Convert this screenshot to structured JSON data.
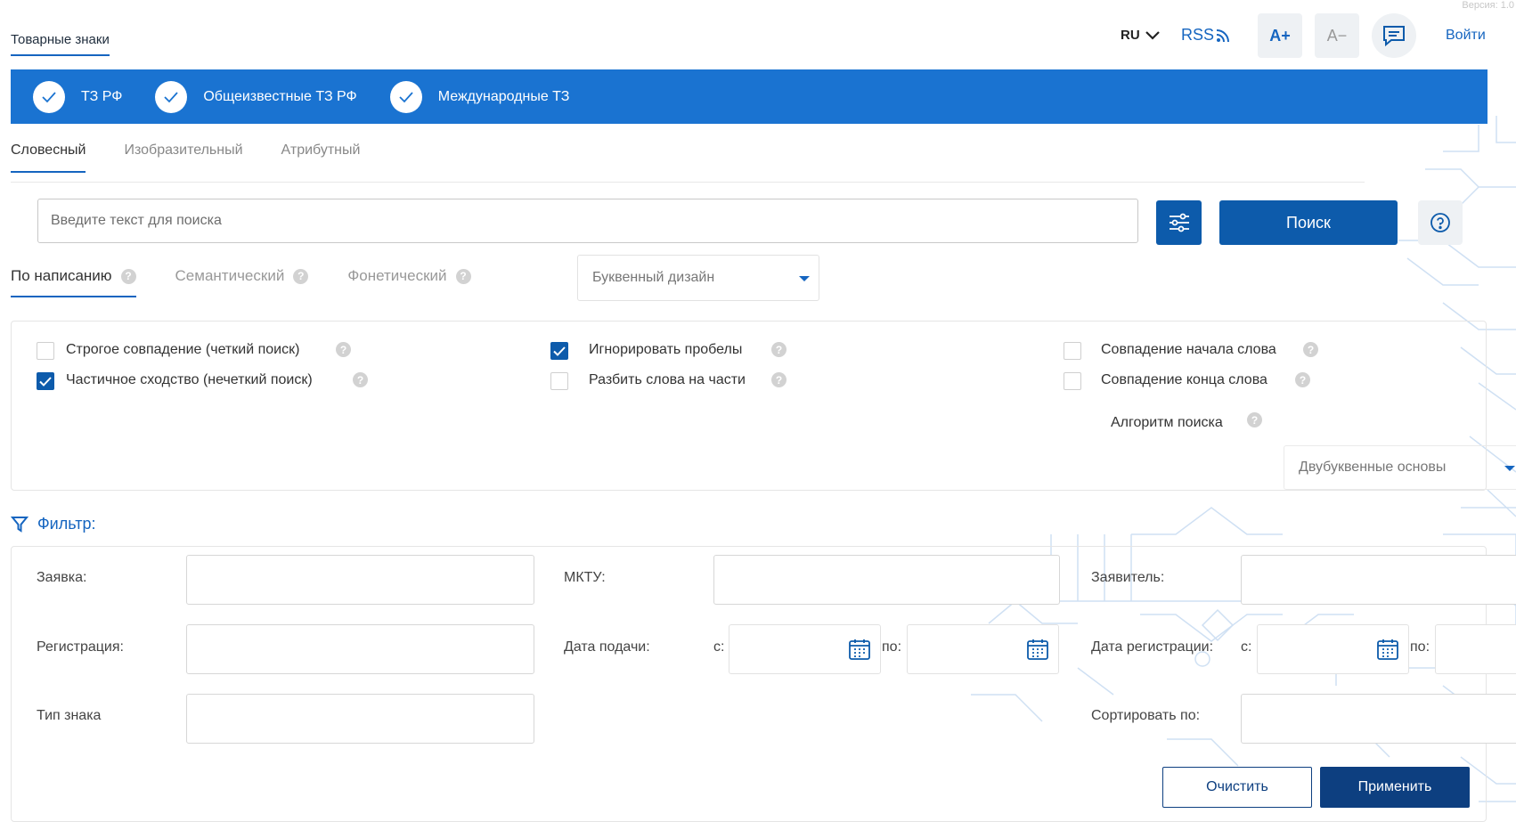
{
  "header": {
    "version": "Версия: 1.0",
    "section_link": "Товарные знаки",
    "lang": "RU",
    "rss": "RSS",
    "font_increase": "A+",
    "font_decrease": "A−",
    "login": "Войти"
  },
  "registries": [
    {
      "label": "ТЗ РФ",
      "checked": true
    },
    {
      "label": "Общеизвестные ТЗ РФ",
      "checked": true
    },
    {
      "label": "Международные ТЗ",
      "checked": true
    }
  ],
  "search_tabs": [
    "Словесный",
    "Изобразительный",
    "Атрибутный"
  ],
  "search": {
    "placeholder": "Введите текст для поиска",
    "button": "Поиск"
  },
  "mode_tabs": [
    "По написанию",
    "Семантический",
    "Фонетический"
  ],
  "design_select": "Буквенный дизайн",
  "options": {
    "strict": {
      "label": "Строгое совпадение (четкий поиск)",
      "checked": false
    },
    "partial": {
      "label": "Частичное сходство (нечеткий поиск)",
      "checked": true
    },
    "ignore_spaces": {
      "label": "Игнорировать пробелы",
      "checked": true
    },
    "split_words": {
      "label": "Разбить слова на части",
      "checked": false
    },
    "word_start": {
      "label": "Совпадение начала слова",
      "checked": false
    },
    "word_end": {
      "label": "Совпадение конца слова",
      "checked": false
    },
    "algorithm_label": "Алгоритм поиска",
    "algorithm_value": "Двубуквенные основы"
  },
  "filter": {
    "title": "Фильтр:",
    "application": "Заявка:",
    "mktu": "МКТУ:",
    "applicant": "Заявитель:",
    "registration": "Регистрация:",
    "filing_date": "Дата подачи:",
    "registration_date": "Дата регистрации:",
    "from": "с:",
    "to": "по:",
    "mark_type": "Тип знака",
    "sort_by": "Сортировать по:",
    "clear": "Очистить",
    "apply": "Применить"
  }
}
